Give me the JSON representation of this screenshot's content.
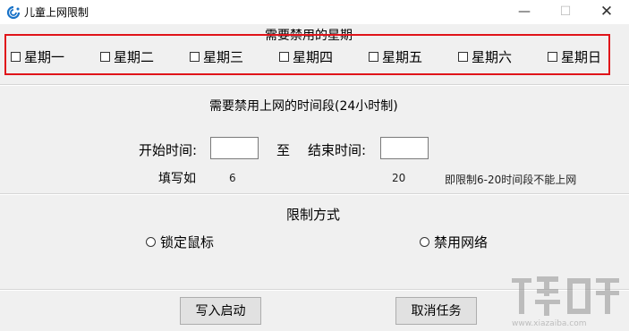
{
  "window": {
    "title": "儿童上网限制",
    "min_glyph": "—",
    "max_glyph": "☐",
    "close_glyph": "✕"
  },
  "days_section": {
    "title": "需要禁用的星期",
    "days": [
      "星期一",
      "星期二",
      "星期三",
      "星期四",
      "星期五",
      "星期六",
      "星期日"
    ]
  },
  "time_section": {
    "title": "需要禁用上网的时间段(24小时制)",
    "start_label": "开始时间:",
    "start_value": "",
    "to_label": "至",
    "end_label": "结束时间:",
    "end_value": "",
    "example_label": "填写如",
    "example_start": "6",
    "example_end": "20",
    "example_note": "即限制6-20时间段不能上网"
  },
  "mode_section": {
    "title": "限制方式",
    "options": [
      "锁定鼠标",
      "禁用网络"
    ]
  },
  "buttons": {
    "start": "写入启动",
    "cancel": "取消任务"
  },
  "watermark": {
    "text": "www.xiazaiba.com"
  },
  "colors": {
    "highlight_box": "#e0141a",
    "window_bg": "#f0f0f0"
  }
}
